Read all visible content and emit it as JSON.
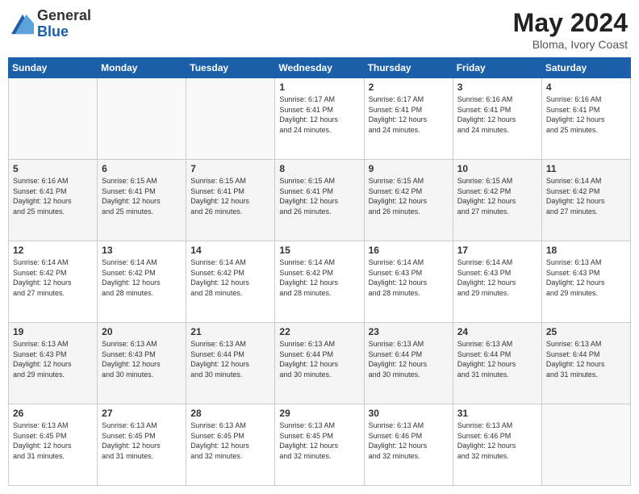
{
  "logo": {
    "general": "General",
    "blue": "Blue"
  },
  "title": {
    "month": "May 2024",
    "location": "Bloma, Ivory Coast"
  },
  "weekdays": [
    "Sunday",
    "Monday",
    "Tuesday",
    "Wednesday",
    "Thursday",
    "Friday",
    "Saturday"
  ],
  "weeks": [
    [
      {
        "day": "",
        "info": ""
      },
      {
        "day": "",
        "info": ""
      },
      {
        "day": "",
        "info": ""
      },
      {
        "day": "1",
        "info": "Sunrise: 6:17 AM\nSunset: 6:41 PM\nDaylight: 12 hours\nand 24 minutes."
      },
      {
        "day": "2",
        "info": "Sunrise: 6:17 AM\nSunset: 6:41 PM\nDaylight: 12 hours\nand 24 minutes."
      },
      {
        "day": "3",
        "info": "Sunrise: 6:16 AM\nSunset: 6:41 PM\nDaylight: 12 hours\nand 24 minutes."
      },
      {
        "day": "4",
        "info": "Sunrise: 6:16 AM\nSunset: 6:41 PM\nDaylight: 12 hours\nand 25 minutes."
      }
    ],
    [
      {
        "day": "5",
        "info": "Sunrise: 6:16 AM\nSunset: 6:41 PM\nDaylight: 12 hours\nand 25 minutes."
      },
      {
        "day": "6",
        "info": "Sunrise: 6:15 AM\nSunset: 6:41 PM\nDaylight: 12 hours\nand 25 minutes."
      },
      {
        "day": "7",
        "info": "Sunrise: 6:15 AM\nSunset: 6:41 PM\nDaylight: 12 hours\nand 26 minutes."
      },
      {
        "day": "8",
        "info": "Sunrise: 6:15 AM\nSunset: 6:41 PM\nDaylight: 12 hours\nand 26 minutes."
      },
      {
        "day": "9",
        "info": "Sunrise: 6:15 AM\nSunset: 6:42 PM\nDaylight: 12 hours\nand 26 minutes."
      },
      {
        "day": "10",
        "info": "Sunrise: 6:15 AM\nSunset: 6:42 PM\nDaylight: 12 hours\nand 27 minutes."
      },
      {
        "day": "11",
        "info": "Sunrise: 6:14 AM\nSunset: 6:42 PM\nDaylight: 12 hours\nand 27 minutes."
      }
    ],
    [
      {
        "day": "12",
        "info": "Sunrise: 6:14 AM\nSunset: 6:42 PM\nDaylight: 12 hours\nand 27 minutes."
      },
      {
        "day": "13",
        "info": "Sunrise: 6:14 AM\nSunset: 6:42 PM\nDaylight: 12 hours\nand 28 minutes."
      },
      {
        "day": "14",
        "info": "Sunrise: 6:14 AM\nSunset: 6:42 PM\nDaylight: 12 hours\nand 28 minutes."
      },
      {
        "day": "15",
        "info": "Sunrise: 6:14 AM\nSunset: 6:42 PM\nDaylight: 12 hours\nand 28 minutes."
      },
      {
        "day": "16",
        "info": "Sunrise: 6:14 AM\nSunset: 6:43 PM\nDaylight: 12 hours\nand 28 minutes."
      },
      {
        "day": "17",
        "info": "Sunrise: 6:14 AM\nSunset: 6:43 PM\nDaylight: 12 hours\nand 29 minutes."
      },
      {
        "day": "18",
        "info": "Sunrise: 6:13 AM\nSunset: 6:43 PM\nDaylight: 12 hours\nand 29 minutes."
      }
    ],
    [
      {
        "day": "19",
        "info": "Sunrise: 6:13 AM\nSunset: 6:43 PM\nDaylight: 12 hours\nand 29 minutes."
      },
      {
        "day": "20",
        "info": "Sunrise: 6:13 AM\nSunset: 6:43 PM\nDaylight: 12 hours\nand 30 minutes."
      },
      {
        "day": "21",
        "info": "Sunrise: 6:13 AM\nSunset: 6:44 PM\nDaylight: 12 hours\nand 30 minutes."
      },
      {
        "day": "22",
        "info": "Sunrise: 6:13 AM\nSunset: 6:44 PM\nDaylight: 12 hours\nand 30 minutes."
      },
      {
        "day": "23",
        "info": "Sunrise: 6:13 AM\nSunset: 6:44 PM\nDaylight: 12 hours\nand 30 minutes."
      },
      {
        "day": "24",
        "info": "Sunrise: 6:13 AM\nSunset: 6:44 PM\nDaylight: 12 hours\nand 31 minutes."
      },
      {
        "day": "25",
        "info": "Sunrise: 6:13 AM\nSunset: 6:44 PM\nDaylight: 12 hours\nand 31 minutes."
      }
    ],
    [
      {
        "day": "26",
        "info": "Sunrise: 6:13 AM\nSunset: 6:45 PM\nDaylight: 12 hours\nand 31 minutes."
      },
      {
        "day": "27",
        "info": "Sunrise: 6:13 AM\nSunset: 6:45 PM\nDaylight: 12 hours\nand 31 minutes."
      },
      {
        "day": "28",
        "info": "Sunrise: 6:13 AM\nSunset: 6:45 PM\nDaylight: 12 hours\nand 32 minutes."
      },
      {
        "day": "29",
        "info": "Sunrise: 6:13 AM\nSunset: 6:45 PM\nDaylight: 12 hours\nand 32 minutes."
      },
      {
        "day": "30",
        "info": "Sunrise: 6:13 AM\nSunset: 6:46 PM\nDaylight: 12 hours\nand 32 minutes."
      },
      {
        "day": "31",
        "info": "Sunrise: 6:13 AM\nSunset: 6:46 PM\nDaylight: 12 hours\nand 32 minutes."
      },
      {
        "day": "",
        "info": ""
      }
    ]
  ]
}
